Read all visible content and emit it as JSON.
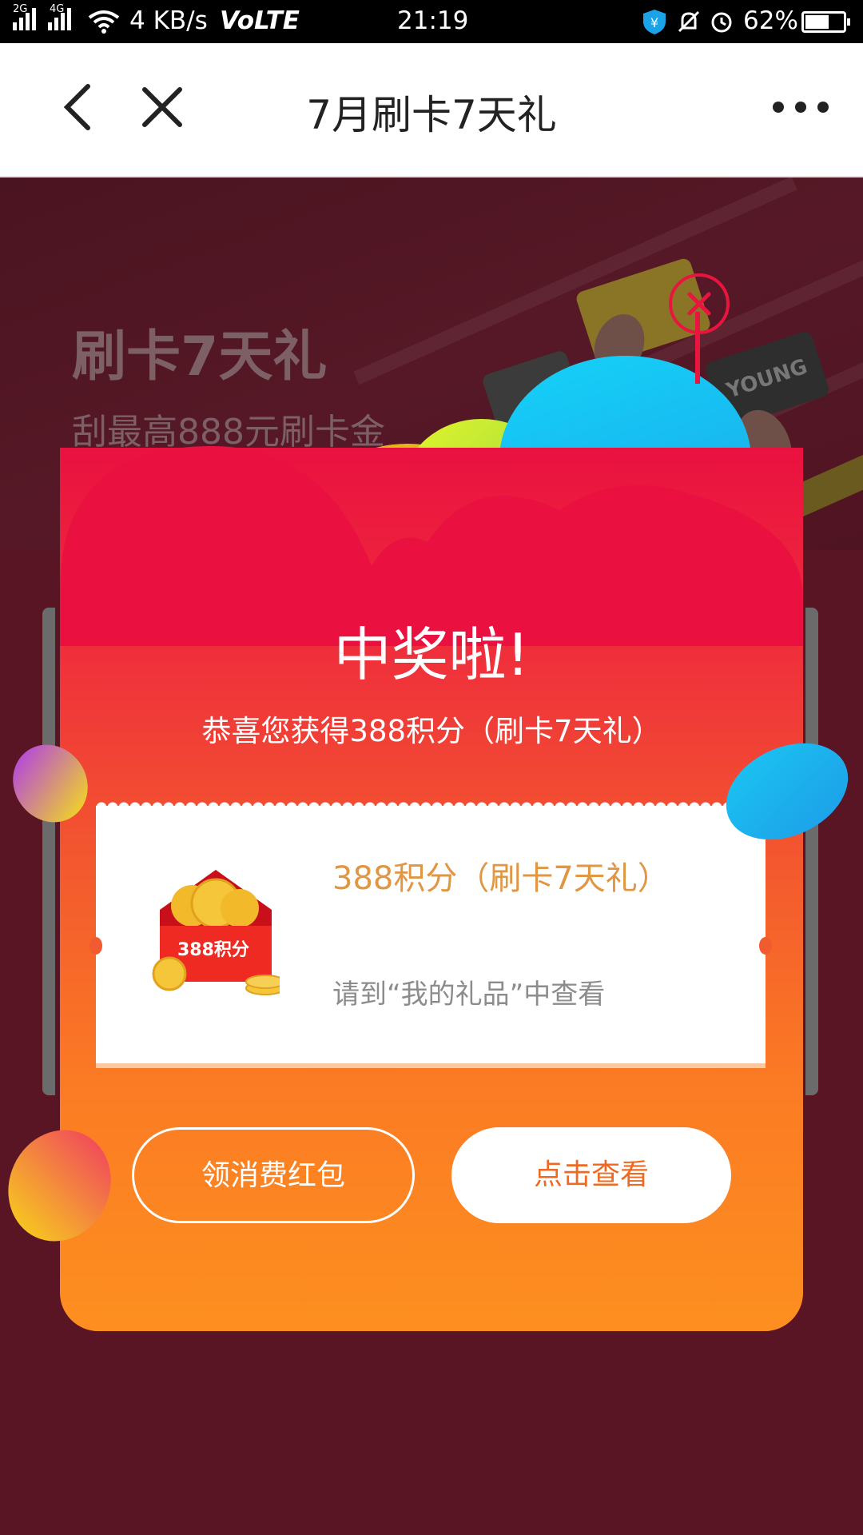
{
  "status_bar": {
    "net_label_1": "2G",
    "net_label_2": "4G",
    "speed": "4 KB/s",
    "volte": "VoLTE",
    "time": "21:19",
    "battery": "62%",
    "battery_level": 0.62
  },
  "nav": {
    "back_icon": "chevron-left-icon",
    "close_icon": "close-icon",
    "title": "7月刷卡7天礼",
    "more_icon": "more-dots-icon"
  },
  "banner": {
    "title": "刷卡7天礼",
    "subtitle": "刮最高888元刷卡金",
    "card_text": "YOUNG"
  },
  "modal": {
    "title": "中奖啦!",
    "subtitle": "恭喜您获得388积分（刷卡7天礼）",
    "prize": {
      "image_label": "388积分",
      "name": "388积分（刷卡7天礼）",
      "tip": "请到“我的礼品”中查看"
    },
    "buttons": {
      "secondary": "领消费红包",
      "primary": "点击查看"
    }
  },
  "colors": {
    "modal_top": "#ea1140",
    "modal_bottom": "#fd8f1f",
    "page_bg": "#5a1524",
    "prize_text": "#e09642"
  }
}
